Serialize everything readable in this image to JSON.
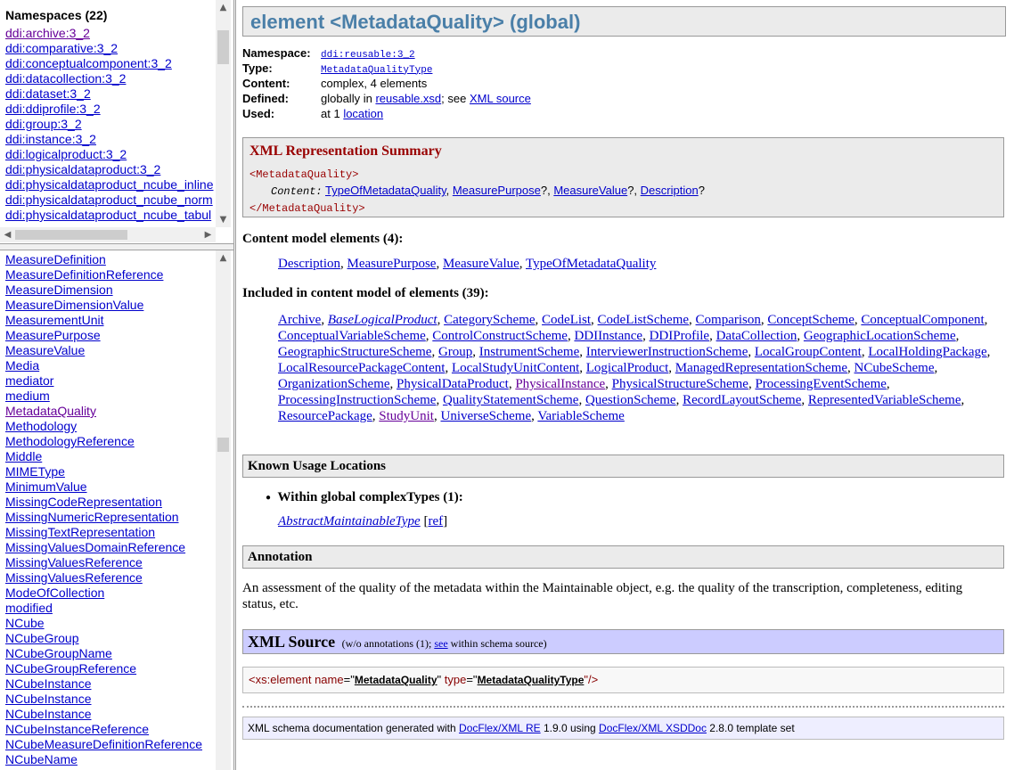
{
  "namespaces": {
    "title": "Namespaces (22)",
    "items": [
      "ddi:archive:3_2",
      "ddi:comparative:3_2",
      "ddi:conceptualcomponent:3_2",
      "ddi:datacollection:3_2",
      "ddi:dataset:3_2",
      "ddi:ddiprofile:3_2",
      "ddi:group:3_2",
      "ddi:instance:3_2",
      "ddi:logicalproduct:3_2",
      "ddi:physicaldataproduct:3_2",
      "ddi:physicaldataproduct_ncube_inline",
      "ddi:physicaldataproduct_ncube_norm",
      "ddi:physicaldataproduct_ncube_tabul"
    ]
  },
  "elements": {
    "items": [
      "MeasureDefinition",
      "MeasureDefinitionReference",
      "MeasureDimension",
      "MeasureDimensionValue",
      "MeasurementUnit",
      "MeasurePurpose",
      "MeasureValue",
      "Media",
      "mediator",
      "medium",
      "MetadataQuality",
      "Methodology",
      "MethodologyReference",
      "Middle",
      "MIMEType",
      "MinimumValue",
      "MissingCodeRepresentation",
      "MissingNumericRepresentation",
      "MissingTextRepresentation",
      "MissingValuesDomainReference",
      "MissingValuesReference",
      "MissingValuesReference",
      "ModeOfCollection",
      "modified",
      "NCube",
      "NCubeGroup",
      "NCubeGroupName",
      "NCubeGroupReference",
      "NCubeInstance",
      "NCubeInstance",
      "NCubeInstance",
      "NCubeInstanceReference",
      "NCubeMeasureDefinitionReference",
      "NCubeName"
    ]
  },
  "main": {
    "title": "element <MetadataQuality> (global)",
    "props": {
      "namespace_label": "Namespace:",
      "namespace_value": "ddi:reusable:3_2",
      "type_label": "Type:",
      "type_value": "MetadataQualityType",
      "content_label": "Content:",
      "content_value": "complex, 4 elements",
      "defined_label": "Defined:",
      "defined_pre": "globally in",
      "defined_file": "reusable.xsd",
      "defined_mid": "; see",
      "defined_link": "XML source",
      "used_label": "Used:",
      "used_pre": "at 1",
      "used_link": "location"
    },
    "summary": {
      "title": "XML Representation Summary",
      "open_tag": "<MetadataQuality>",
      "content_label": "Content:",
      "items": [
        "TypeOfMetadataQuality",
        "MeasurePurpose",
        "MeasureValue",
        "Description"
      ],
      "sep1": ", ",
      "sep2": "?, ",
      "sep3": "?, ",
      "end": "?",
      "close_tag": "</MetadataQuality>"
    },
    "content_model": {
      "heading": "Content model elements (4):",
      "items": [
        "Description",
        "MeasurePurpose",
        "MeasureValue",
        "TypeOfMetadataQuality"
      ]
    },
    "included": {
      "heading": "Included in content model of elements (39):",
      "items": [
        "Archive",
        "BaseLogicalProduct",
        "CategoryScheme",
        "CodeList",
        "CodeListScheme",
        "Comparison",
        "ConceptScheme",
        "ConceptualComponent",
        "ConceptualVariableScheme",
        "ControlConstructScheme",
        "DDIInstance",
        "DDIProfile",
        "DataCollection",
        "GeographicLocationScheme",
        "GeographicStructureScheme",
        "Group",
        "InstrumentScheme",
        "InterviewerInstructionScheme",
        "LocalGroupContent",
        "LocalHoldingPackage",
        "LocalResourcePackageContent",
        "LocalStudyUnitContent",
        "LogicalProduct",
        "ManagedRepresentationScheme",
        "NCubeScheme",
        "OrganizationScheme",
        "PhysicalDataProduct",
        "PhysicalInstance",
        "PhysicalStructureScheme",
        "ProcessingEventScheme",
        "ProcessingInstructionScheme",
        "QualityStatementScheme",
        "QuestionScheme",
        "RecordLayoutScheme",
        "RepresentedVariableScheme",
        "ResourcePackage",
        "StudyUnit",
        "UniverseScheme",
        "VariableScheme"
      ]
    },
    "usage": {
      "heading": "Known Usage Locations",
      "bullet": "Within global complexTypes (1):",
      "type_link": "AbstractMaintainableType",
      "ref_link": "ref"
    },
    "annotation": {
      "heading": "Annotation",
      "text": "An assessment of the quality of the metadata within the Maintainable object, e.g. the quality of the transcription, completeness, editing status, etc."
    },
    "xml_source": {
      "heading": "XML Source",
      "note_pre": "(w/o annotations (1);",
      "note_link": "see",
      "note_post": "within schema source)",
      "code_open": "<xs:element ",
      "attr_name": "name",
      "eq_q": "=\"",
      "name_value": "MetadataQuality",
      "q_sp": "\" ",
      "attr_type": "type",
      "type_value": "MetadataQualityType",
      "code_close": "\"/>"
    },
    "footer": {
      "pre": "XML schema documentation generated with",
      "link1": "DocFlex/XML RE",
      "mid": "1.9.0 using",
      "link2": "DocFlex/XML XSDDoc",
      "post": "2.8.0 template set"
    }
  }
}
